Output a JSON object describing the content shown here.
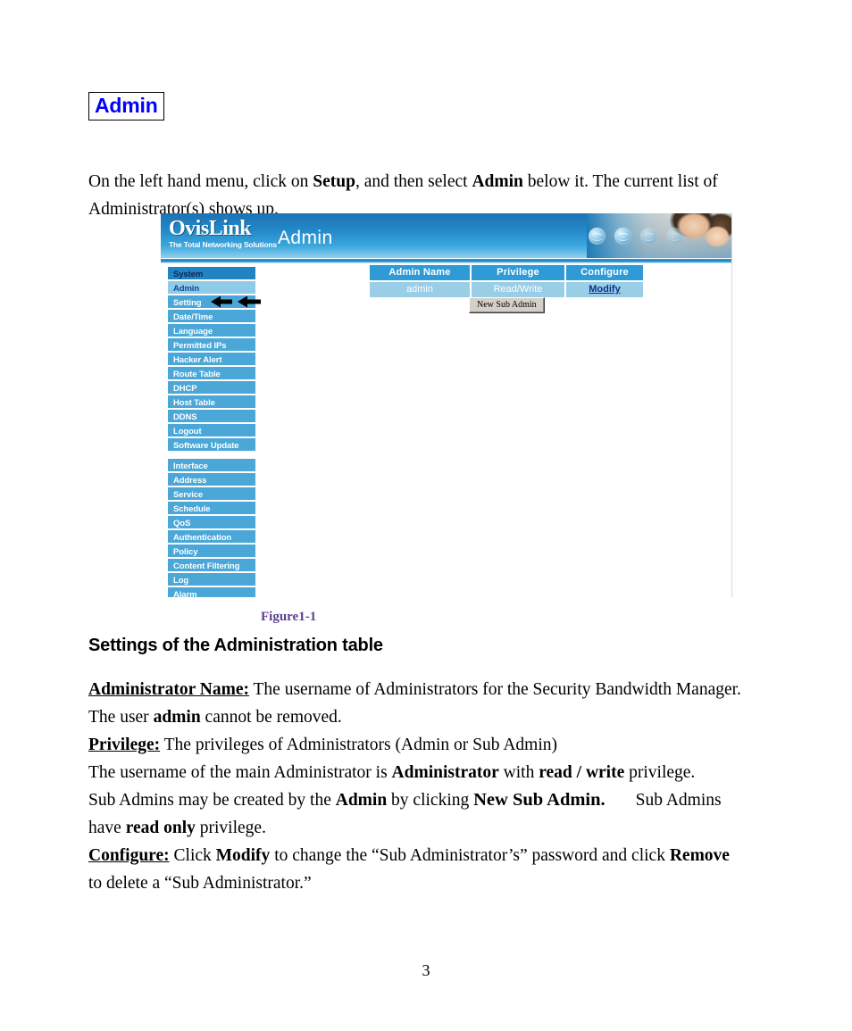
{
  "document": {
    "title": "Admin",
    "page_number": "3",
    "figure_caption": "Figure1-1",
    "section_heading": "Settings of the Administration table"
  },
  "intro": {
    "part1": "On the left hand menu, click on ",
    "bold1": "Setup",
    "part2": ", and then select ",
    "bold2": "Admin",
    "part3": " below it. The current list of Administrator(s) shows up."
  },
  "screenshot": {
    "brand_name": "OvisLink",
    "brand_tagline": "The Total Networking Solutions",
    "page_title": "Admin",
    "menu_groups": [
      {
        "section_label": "System",
        "items": [
          "Admin",
          "Setting",
          "Date/Time",
          "Language",
          "Permitted IPs",
          "Hacker Alert",
          "Route Table",
          "DHCP",
          "Host Table",
          "DDNS",
          "Logout",
          "Software Update"
        ]
      },
      {
        "section_label": "",
        "items": [
          "Interface",
          "Address",
          "Service",
          "Schedule",
          "QoS",
          "Authentication",
          "Policy",
          "Content Filtering",
          "Log",
          "Alarm"
        ]
      }
    ],
    "table": {
      "headers": [
        "Admin Name",
        "Privilege",
        "Configure"
      ],
      "rows": [
        {
          "admin_name": "admin",
          "privilege": "Read/Write",
          "configure": "Modify"
        }
      ]
    },
    "new_sub_admin_button": "New Sub Admin",
    "colors": {
      "header_blue": "#2e9bd6",
      "row_blue": "#9acde6",
      "menu_blue": "#4aa7d8",
      "menu_section": "#2183c0",
      "menu_active": "#8ecbe8",
      "link_blue": "#0b2f8a"
    }
  },
  "settings": {
    "administrator_name": {
      "label": "Administrator Name:",
      "line1": " The username of Administrators for the Security Bandwidth Manager.",
      "line2_pre": "The user ",
      "line2_bold": "admin",
      "line2_post": " cannot be removed."
    },
    "privilege": {
      "label": "Privilege:",
      "line1": " The privileges of Administrators (Admin or Sub Admin)",
      "line2_pre": "The username of the main Administrator is ",
      "line2_bold1": "Administrator",
      "line2_mid": " with ",
      "line2_bold2": "read / write",
      "line2_post": " privilege.",
      "line3_pre": "Sub Admins may be created by the ",
      "line3_bold1": "Admin",
      "line3_mid": " by clicking ",
      "line3_button": "New Sub Admin.",
      "line3_post": "Sub Admins",
      "line4_pre": "have ",
      "line4_bold": "read only",
      "line4_post": " privilege."
    },
    "configure": {
      "label": "Configure:",
      "line1_pre": " Click ",
      "line1_bold1": "Modify",
      "line1_mid": " to change the “Sub Administrator’s” password and click ",
      "line1_bold2": "Remove",
      "line2": "to delete a “Sub Administrator.”"
    }
  }
}
